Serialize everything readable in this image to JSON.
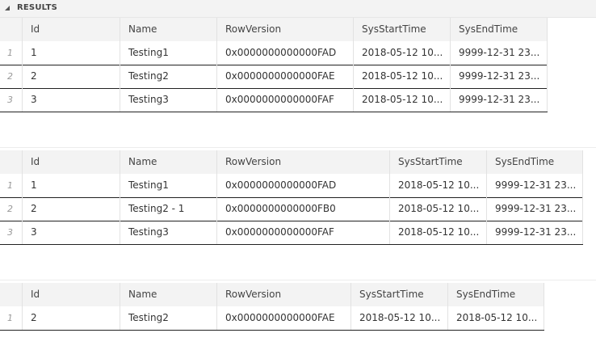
{
  "panel": {
    "title": "RESULTS"
  },
  "grids": [
    {
      "columns": [
        "Id",
        "Name",
        "RowVersion",
        "SysStartTime",
        "SysEndTime"
      ],
      "rows": [
        {
          "num": "1",
          "cells": [
            "1",
            "Testing1",
            "0x0000000000000FAD",
            "2018-05-12 10...",
            "9999-12-31 23..."
          ]
        },
        {
          "num": "2",
          "cells": [
            "2",
            "Testing2",
            "0x0000000000000FAE",
            "2018-05-12 10...",
            "9999-12-31 23..."
          ]
        },
        {
          "num": "3",
          "cells": [
            "3",
            "Testing3",
            "0x0000000000000FAF",
            "2018-05-12 10...",
            "9999-12-31 23..."
          ]
        }
      ]
    },
    {
      "columns": [
        "Id",
        "Name",
        "RowVersion",
        "SysStartTime",
        "SysEndTime"
      ],
      "rows": [
        {
          "num": "1",
          "cells": [
            "1",
            "Testing1",
            "0x0000000000000FAD",
            "2018-05-12 10...",
            "9999-12-31 23..."
          ]
        },
        {
          "num": "2",
          "cells": [
            "2",
            "Testing2 - 1",
            "0x0000000000000FB0",
            "2018-05-12 10...",
            "9999-12-31 23..."
          ]
        },
        {
          "num": "3",
          "cells": [
            "3",
            "Testing3",
            "0x0000000000000FAF",
            "2018-05-12 10...",
            "9999-12-31 23..."
          ]
        }
      ]
    },
    {
      "columns": [
        "Id",
        "Name",
        "RowVersion",
        "SysStartTime",
        "SysEndTime"
      ],
      "rows": [
        {
          "num": "1",
          "cells": [
            "2",
            "Testing2",
            "0x0000000000000FAE",
            "2018-05-12 10...",
            "2018-05-12 10..."
          ]
        }
      ]
    }
  ]
}
